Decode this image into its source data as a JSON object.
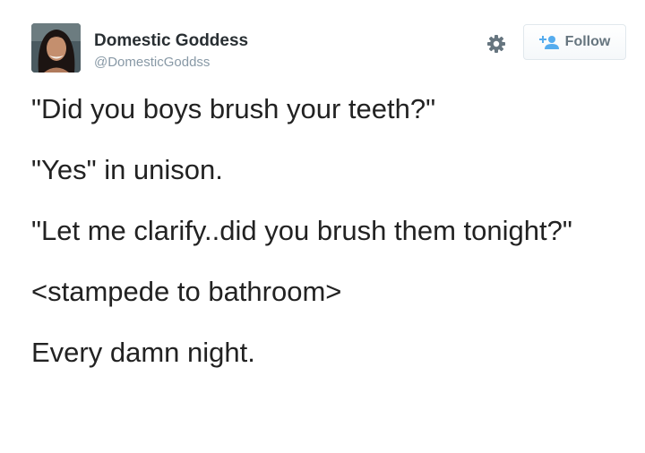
{
  "author": {
    "display_name": "Domestic Goddess",
    "handle": "@DomesticGoddss",
    "avatar_icon": "profile-photo"
  },
  "actions": {
    "settings_icon": "gear-icon",
    "follow_icon": "add-user-icon",
    "follow_label": "Follow"
  },
  "tweet": {
    "lines": [
      "\"Did you boys brush your teeth?\"",
      "\"Yes\" in unison.",
      "\"Let me clarify..did you brush them tonight?\"",
      "<stampede to bathroom>",
      "Every damn night."
    ]
  },
  "colors": {
    "name": "#292f33",
    "handle": "#8899a6",
    "text": "#222222",
    "follow_icon": "#55acee",
    "button_border": "#e1e8ed"
  }
}
